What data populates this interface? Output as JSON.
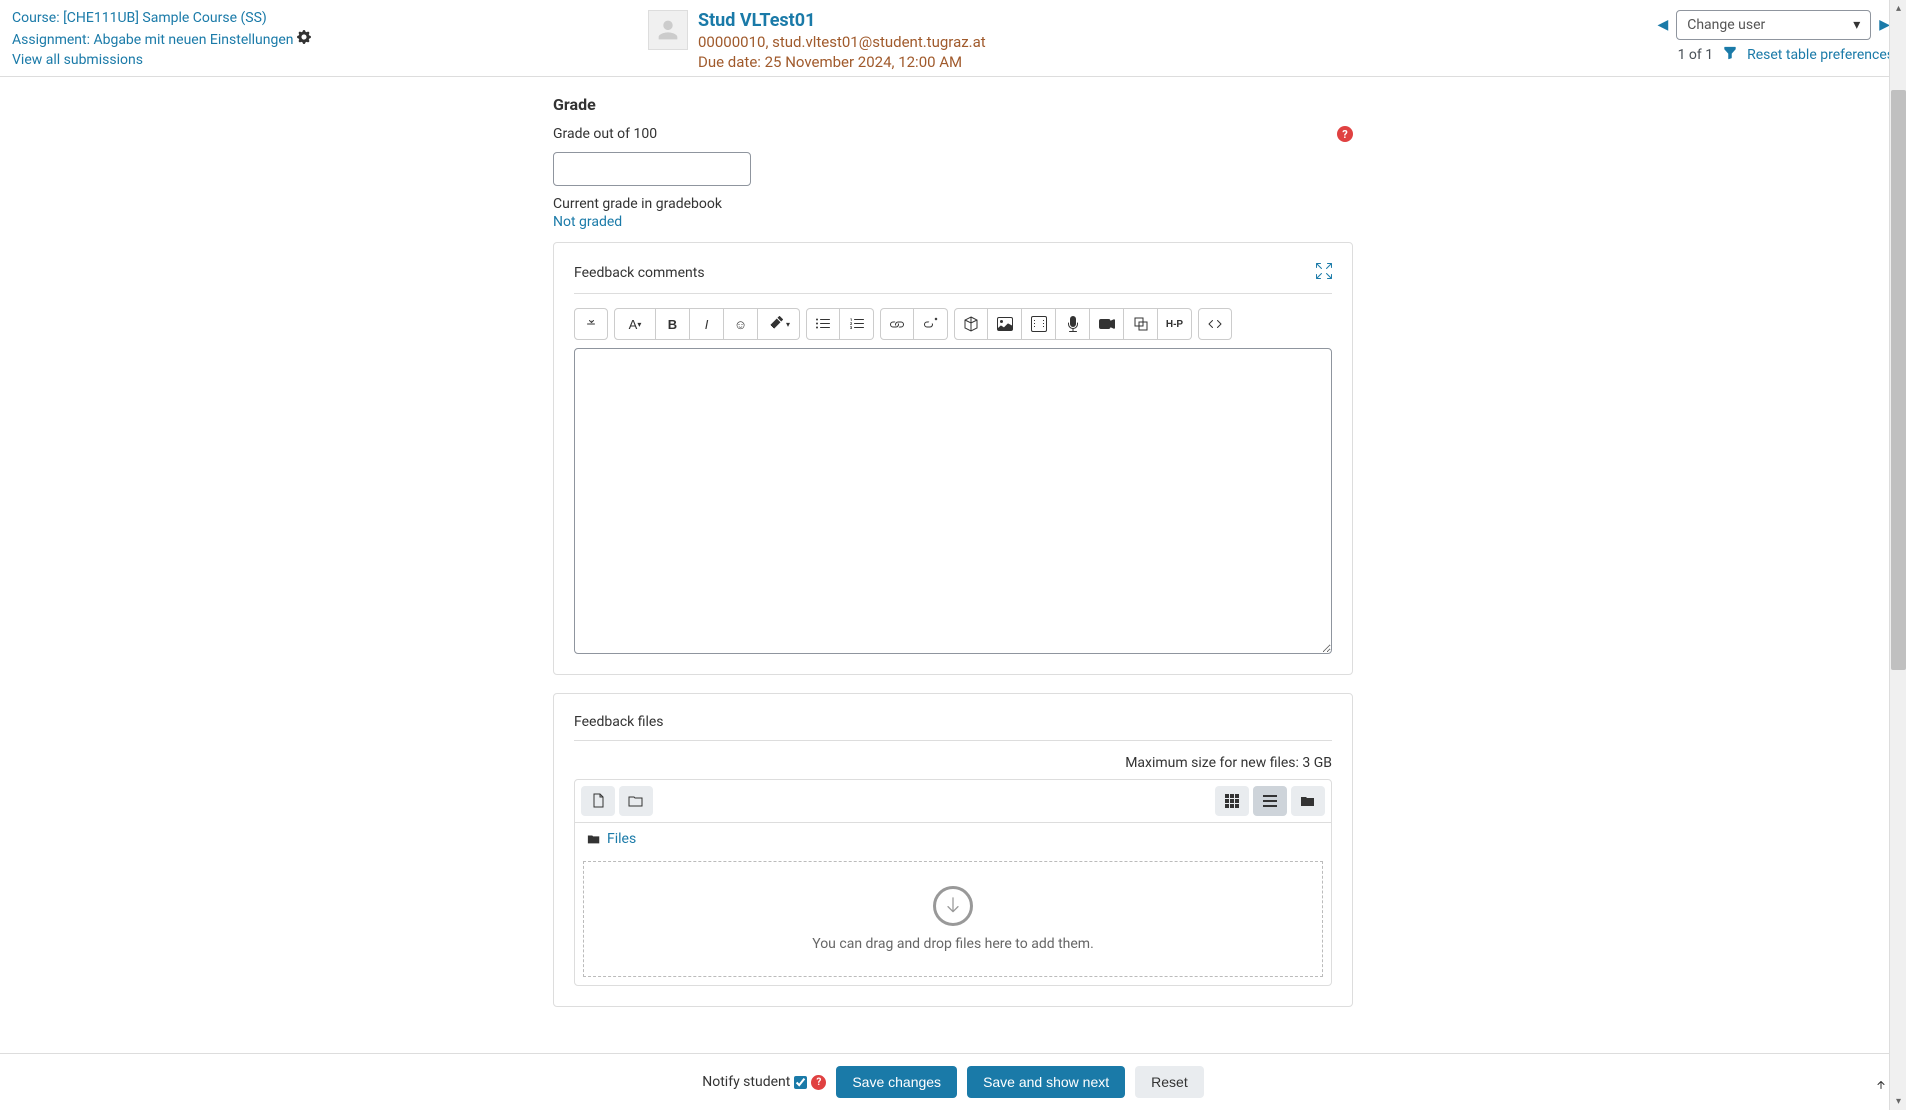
{
  "header": {
    "course_link": "Course: [CHE111UB] Sample Course (SS)",
    "assignment_link": "Assignment: Abgabe mit neuen Einstellungen",
    "view_all_link": "View all submissions",
    "user_name": "Stud VLTest01",
    "user_meta": "00000010, stud.vltest01@student.tugraz.at",
    "due_date": "Due date: 25 November 2024, 12:00 AM",
    "change_user_placeholder": "Change user",
    "count_text": "1 of 1",
    "reset_prefs": "Reset table preferences"
  },
  "grade": {
    "section_title": "Grade",
    "label": "Grade out of 100",
    "gradebook_label": "Current grade in gradebook",
    "not_graded": "Not graded"
  },
  "feedback_comments": {
    "title": "Feedback comments"
  },
  "feedback_files": {
    "title": "Feedback files",
    "max_size": "Maximum size for new files: 3 GB",
    "files_link": "Files",
    "dropzone_text": "You can drag and drop files here to add them."
  },
  "footer": {
    "notify_label": "Notify student",
    "save_changes": "Save changes",
    "save_next": "Save and show next",
    "reset": "Reset"
  },
  "toolbar": {
    "h5p": "H-P"
  }
}
